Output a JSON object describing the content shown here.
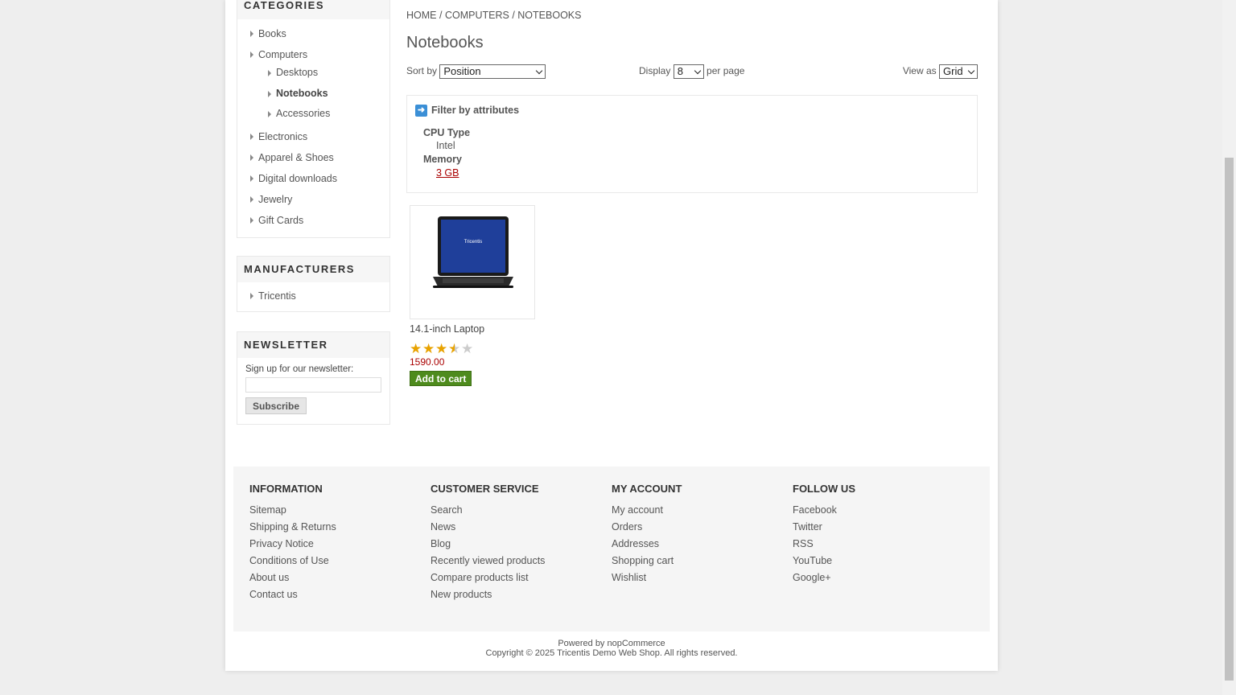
{
  "sidebar": {
    "categories": {
      "title": "CATEGORIES",
      "items": [
        {
          "label": "Books"
        },
        {
          "label": "Computers",
          "children": [
            {
              "label": "Desktops"
            },
            {
              "label": "Notebooks",
              "active": true
            },
            {
              "label": "Accessories"
            }
          ]
        },
        {
          "label": "Electronics"
        },
        {
          "label": "Apparel & Shoes"
        },
        {
          "label": "Digital downloads"
        },
        {
          "label": "Jewelry"
        },
        {
          "label": "Gift Cards"
        }
      ]
    },
    "manufacturers": {
      "title": "MANUFACTURERS",
      "items": [
        {
          "label": "Tricentis"
        }
      ]
    },
    "newsletter": {
      "title": "NEWSLETTER",
      "label": "Sign up for our newsletter:",
      "email_value": "",
      "subscribe_label": "Subscribe"
    }
  },
  "breadcrumb": {
    "home": "HOME",
    "sep": "/",
    "computers": "COMPUTERS",
    "current": "NOTEBOOKS"
  },
  "page_title": "Notebooks",
  "toolbar": {
    "sort_label": "Sort by",
    "sort_value": "Position",
    "display_label": "Display",
    "display_value": "8",
    "per_page_label": "per page",
    "view_label": "View as",
    "view_value": "Grid"
  },
  "filter": {
    "title": "Filter by attributes",
    "groups": [
      {
        "name": "CPU Type",
        "value": "Intel"
      },
      {
        "name": "Memory",
        "value": "3 GB"
      }
    ]
  },
  "products": [
    {
      "title": "14.1-inch Laptop",
      "rating": 3.5,
      "rating_max": 5,
      "price": "1590.00",
      "add_to_cart_label": "Add to cart",
      "screen_logo": "Tricentis"
    }
  ],
  "footer": {
    "columns": [
      {
        "title": "INFORMATION",
        "links": [
          "Sitemap",
          "Shipping & Returns",
          "Privacy Notice",
          "Conditions of Use",
          "About us",
          "Contact us"
        ]
      },
      {
        "title": "CUSTOMER SERVICE",
        "links": [
          "Search",
          "News",
          "Blog",
          "Recently viewed products",
          "Compare products list",
          "New products"
        ]
      },
      {
        "title": "MY ACCOUNT",
        "links": [
          "My account",
          "Orders",
          "Addresses",
          "Shopping cart",
          "Wishlist"
        ]
      },
      {
        "title": "FOLLOW US",
        "links": [
          "Facebook",
          "Twitter",
          "RSS",
          "YouTube",
          "Google+"
        ]
      }
    ],
    "powered_prefix": "Powered by ",
    "powered_link": "nopCommerce",
    "copyright": "Copyright © 2025 Tricentis Demo Web Shop. All rights reserved."
  },
  "colors": {
    "accent_price": "#aa0000",
    "add_to_cart": "#4e8b1d",
    "filter_icon": "#3b8fd6"
  }
}
